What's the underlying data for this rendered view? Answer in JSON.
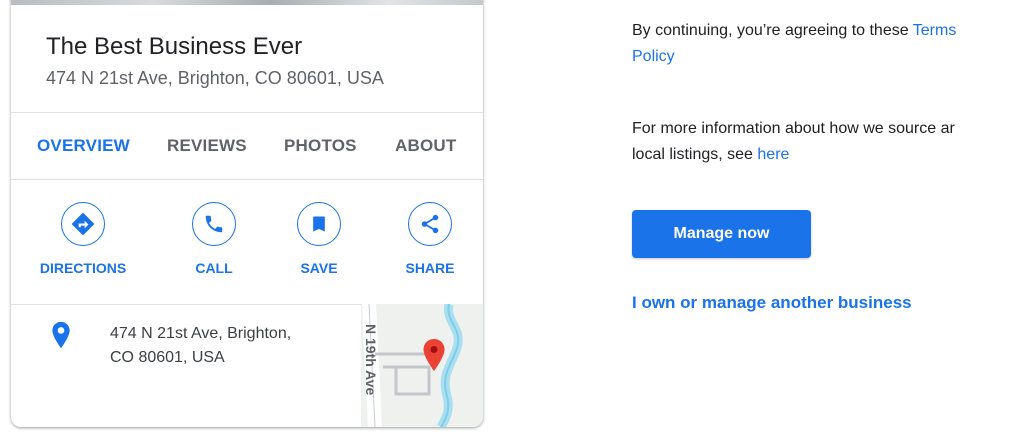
{
  "card": {
    "business_name": "The Best Business Ever",
    "address": "474 N 21st Ave, Brighton, CO 80601, USA",
    "tabs": [
      {
        "label": "OVERVIEW",
        "active": true
      },
      {
        "label": "REVIEWS",
        "active": false
      },
      {
        "label": "PHOTOS",
        "active": false
      },
      {
        "label": "ABOUT",
        "active": false
      }
    ],
    "actions": [
      {
        "label": "DIRECTIONS",
        "icon": "directions-icon"
      },
      {
        "label": "CALL",
        "icon": "phone-icon"
      },
      {
        "label": "SAVE",
        "icon": "bookmark-icon"
      },
      {
        "label": "SHARE",
        "icon": "share-icon"
      }
    ],
    "location_line1": "474 N 21st Ave, Brighton,",
    "location_line2": "CO 80601, USA",
    "map_road_label": "N 19th Ave"
  },
  "info": {
    "terms_prefix": "By continuing, you’re agreeing to these ",
    "terms_link": "Terms",
    "policy_link": "Policy",
    "source_prefix": "For more information about how we source ar",
    "source_line2": "local listings, see ",
    "source_link": "here"
  },
  "manage_button": "Manage now",
  "other_business_link": "I own or manage another business",
  "colors": {
    "accent": "#1a73e8",
    "text_primary": "#202124",
    "text_secondary": "#5f6368",
    "pin_red": "#ea4335"
  }
}
